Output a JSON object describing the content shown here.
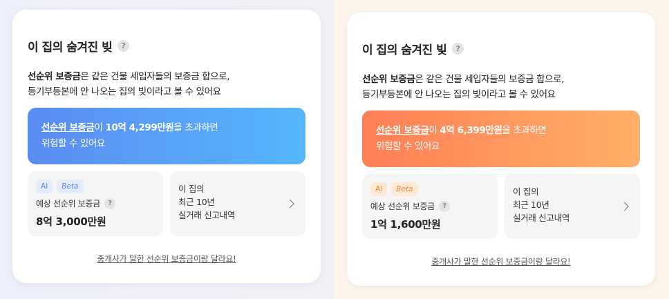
{
  "panels": [
    {
      "variant": "blue",
      "accent_color": "#5b8cf3",
      "title": "이 집의 숨겨진 빚",
      "help_icon": "question-mark-icon",
      "description_bold": "선순위 보증금",
      "description_rest": "은 같은 건물 세입자들의 보증금 합으로,",
      "description_line2": "등기부등본에 안 나오는 집의 빚이라고 볼 수 있어요",
      "banner": {
        "link_text": "선순위 보증금",
        "text_mid": "이 ",
        "amount": "10억 4,299만원",
        "text_after": "을 초과하면",
        "line2": "위험할 수 있어요"
      },
      "estimate": {
        "badge_ai": "AI",
        "badge_beta": "Beta",
        "label": "예상 선순위 보증금",
        "value": "8억 3,000만원"
      },
      "history": {
        "line1": "이 집의",
        "line2": "최근 10년",
        "line3": "실거래 신고내역"
      },
      "bottom_link": "중개사가 말한 선순위 보증금이랑 달라요!"
    },
    {
      "variant": "orange",
      "accent_color": "#ff7f55",
      "title": "이 집의 숨겨진 빚",
      "help_icon": "question-mark-icon",
      "description_bold": "선순위 보증금",
      "description_rest": "은 같은 건물 세입자들의 보증금 합으로,",
      "description_line2": "등기부등본에 안 나오는 집의 빚이라고 볼 수 있어요",
      "banner": {
        "link_text": "선순위 보증금",
        "text_mid": "이 ",
        "amount": "4억 6,399만원",
        "text_after": "을 초과하면",
        "line2": "위험할 수 있어요"
      },
      "estimate": {
        "badge_ai": "AI",
        "badge_beta": "Beta",
        "label": "예상 선순위 보증금",
        "value": "1억 1,600만원"
      },
      "history": {
        "line1": "이 집의",
        "line2": "최근 10년",
        "line3": "실거래 신고내역"
      },
      "bottom_link": "중개사가 말한 선순위 보증금이랑 달라요!"
    }
  ]
}
